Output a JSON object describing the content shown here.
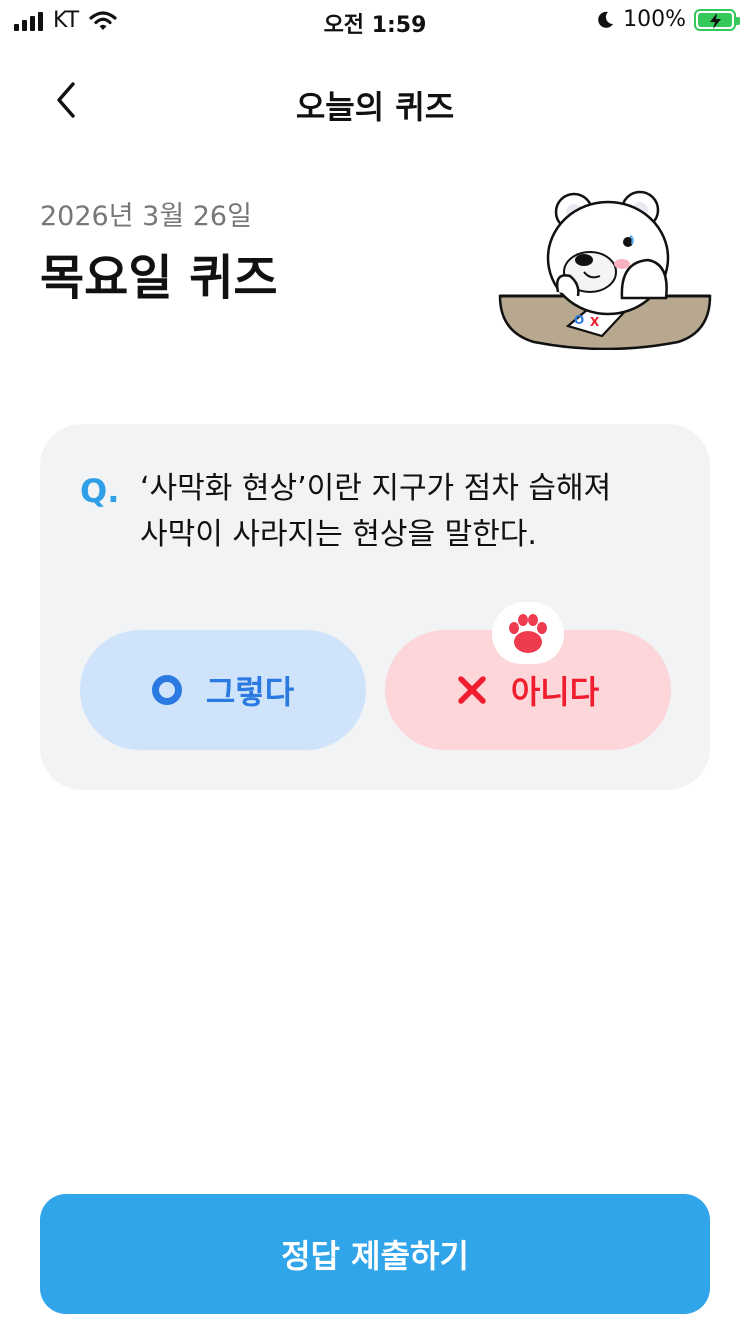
{
  "status_bar": {
    "carrier": "KT",
    "time": "오전 1:59",
    "battery": "100%"
  },
  "header": {
    "title": "오늘의 퀴즈",
    "back_icon": "chevron-left-icon"
  },
  "quiz": {
    "date": "2026년 3월 26일",
    "heading": "목요일 퀴즈",
    "q_label": "Q.",
    "question_line1": "‘사막화 현상’이란 지구가 점차 습해져",
    "question_line2": "사막이 사라지는 현상을 말한다.",
    "illustration": {
      "card_mark_o": "O",
      "card_mark_x": "X"
    },
    "options": {
      "yes": {
        "label": "그렇다",
        "icon": "circle-o-icon"
      },
      "no": {
        "label": "아니다",
        "icon": "x-mark-icon",
        "selected": true
      }
    }
  },
  "submit": {
    "label": "정답 제출하기"
  },
  "colors": {
    "accent": "#31a5e9",
    "yes_bg": "#cfe3fb",
    "yes_fg": "#2a7ae2",
    "no_bg": "#fcd6d9",
    "no_fg": "#f01d2e",
    "card_bg": "#f2f3f5"
  }
}
